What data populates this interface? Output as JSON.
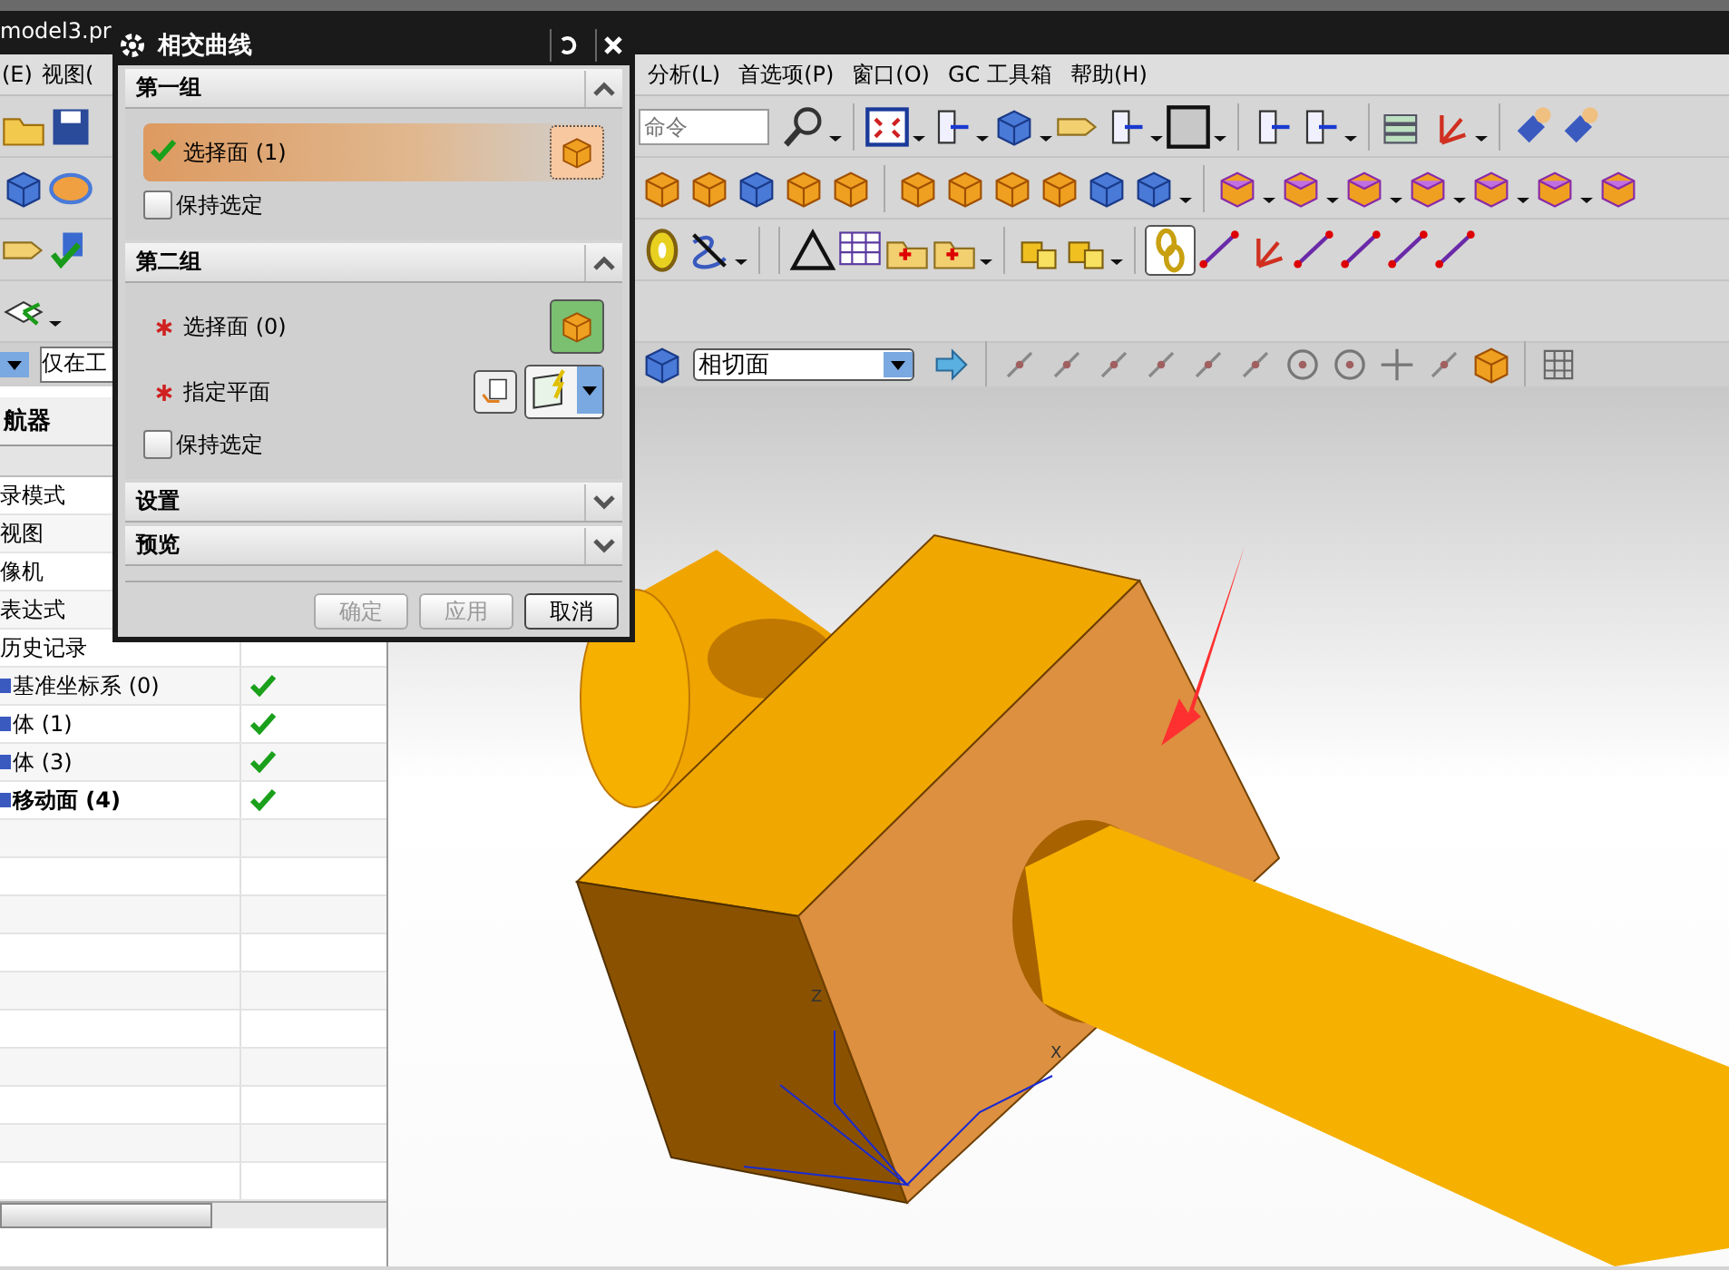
{
  "window": {
    "title": "model3.pr"
  },
  "menu": [
    "(E)",
    "视图(",
    "分析(L)",
    "首选项(P)",
    "窗口(O)",
    "GC 工具箱",
    "帮助(H)"
  ],
  "command_search": {
    "placeholder": "命令"
  },
  "selection_bar": {
    "filter": "仅在工",
    "rule": "相切面"
  },
  "navigator": {
    "title": "航器",
    "rows": [
      {
        "label": "录模式",
        "checked": false,
        "current": false
      },
      {
        "label": "视图",
        "checked": false,
        "current": false
      },
      {
        "label": "像机",
        "checked": false,
        "current": false
      },
      {
        "label": "表达式",
        "checked": false,
        "current": false
      },
      {
        "label": "历史记录",
        "checked": false,
        "current": false
      },
      {
        "label": "基准坐标系 (0)",
        "checked": true,
        "current": false
      },
      {
        "label": "体 (1)",
        "checked": true,
        "current": false
      },
      {
        "label": "体 (3)",
        "checked": true,
        "current": false
      },
      {
        "label": "移动面 (4)",
        "checked": true,
        "current": true
      }
    ]
  },
  "viewport": {
    "axis_labels": [
      "Z",
      "X"
    ]
  },
  "dialog": {
    "title": "相交曲线",
    "groups": [
      {
        "title": "第一组",
        "expanded": true,
        "items": [
          {
            "kind": "select",
            "label": "选择面 (1)",
            "done": true,
            "selected": true
          },
          {
            "kind": "checkbox",
            "label": "保持选定",
            "checked": false
          }
        ]
      },
      {
        "title": "第二组",
        "expanded": true,
        "items": [
          {
            "kind": "select",
            "label": "选择面 (0)",
            "done": false,
            "selected": false
          },
          {
            "kind": "plane",
            "label": "指定平面",
            "done": false
          },
          {
            "kind": "checkbox",
            "label": "保持选定",
            "checked": false
          }
        ]
      },
      {
        "title": "设置",
        "expanded": false
      },
      {
        "title": "预览",
        "expanded": false
      }
    ],
    "buttons": [
      {
        "label": "确定",
        "disabled": true
      },
      {
        "label": "应用",
        "disabled": true
      },
      {
        "label": "取消",
        "disabled": false
      }
    ]
  }
}
